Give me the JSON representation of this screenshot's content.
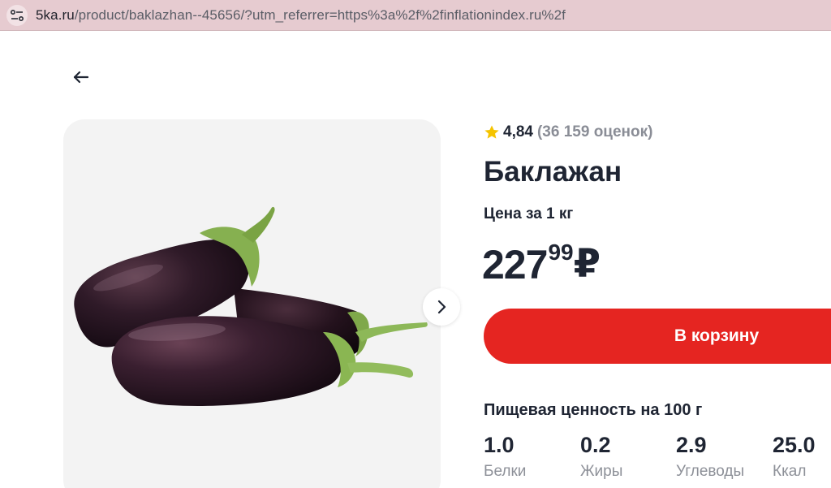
{
  "browser": {
    "url_domain": "5ka.ru",
    "url_path": "/product/baklazhan--45656/?utm_referrer=https%3a%2f%2finflationindex.ru%2f"
  },
  "product": {
    "rating_score": "4,84",
    "rating_count": "(36 159 оценок)",
    "title": "Баклажан",
    "unit_label": "Цена за 1 кг",
    "price_rub": "227",
    "price_kop": "99",
    "currency": "₽",
    "cart_button": "В корзину",
    "image_alt": "eggplant-photo"
  },
  "nutrition": {
    "title": "Пищевая ценность на 100 г",
    "items": [
      {
        "value": "1.0",
        "label": "Белки"
      },
      {
        "value": "0.2",
        "label": "Жиры"
      },
      {
        "value": "2.9",
        "label": "Углеводы"
      },
      {
        "value": "25.0",
        "label": "Ккал"
      }
    ]
  },
  "colors": {
    "accent": "#e52521",
    "star": "#f5c400",
    "text": "#1f2533",
    "muted": "#8a8d96",
    "address_bar": "#e6cbd0"
  },
  "icons": [
    "site-settings-icon",
    "back-arrow-icon",
    "chevron-right-icon",
    "star-icon"
  ]
}
